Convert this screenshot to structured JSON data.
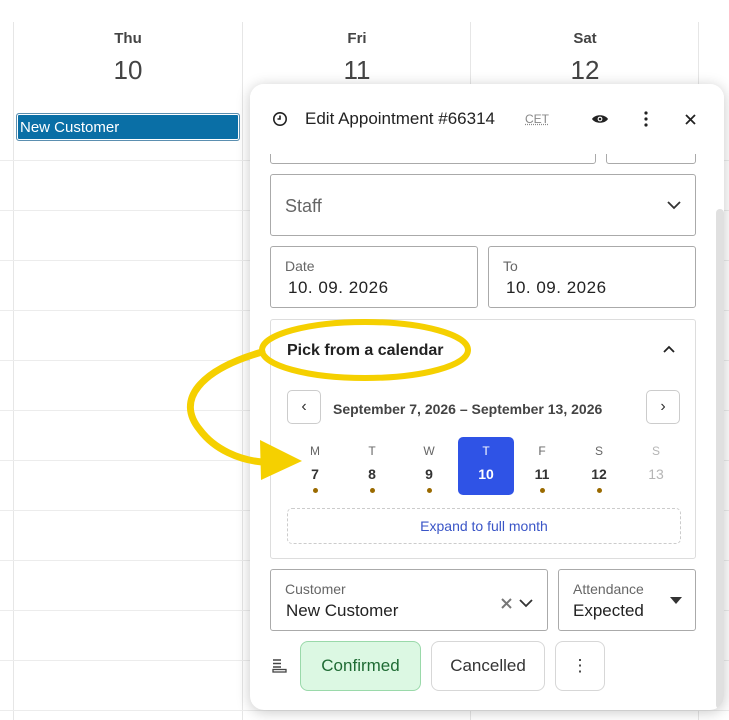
{
  "calendar": {
    "days": [
      {
        "name": "Thu",
        "num": "10"
      },
      {
        "name": "Fri",
        "num": "11"
      },
      {
        "name": "Sat",
        "num": "12"
      }
    ],
    "event": {
      "title": "New Customer",
      "color": "#0a6fa6"
    }
  },
  "modal": {
    "title": "Edit Appointment #66314",
    "timezone": "CET",
    "staff_placeholder": "Staff",
    "date": {
      "label": "Date",
      "value": "10. 09. 2026"
    },
    "to": {
      "label": "To",
      "value": "10. 09. 2026"
    },
    "picker": {
      "title": "Pick from a calendar",
      "range": "September 7, 2026 – September 13, 2026",
      "prev": "‹",
      "next": "›",
      "days": [
        {
          "wd": "M",
          "dn": "7"
        },
        {
          "wd": "T",
          "dn": "8"
        },
        {
          "wd": "W",
          "dn": "9"
        },
        {
          "wd": "T",
          "dn": "10"
        },
        {
          "wd": "F",
          "dn": "11"
        },
        {
          "wd": "S",
          "dn": "12"
        },
        {
          "wd": "S",
          "dn": "13"
        }
      ],
      "expand": "Expand to full month",
      "selected_color": "#2f53e6"
    },
    "customer": {
      "label": "Customer",
      "value": "New Customer"
    },
    "attendance": {
      "label": "Attendance",
      "value": "Expected"
    },
    "status": {
      "confirmed": "Confirmed",
      "cancelled": "Cancelled",
      "more": "⋮"
    }
  },
  "annotation_color": "#f5d000"
}
